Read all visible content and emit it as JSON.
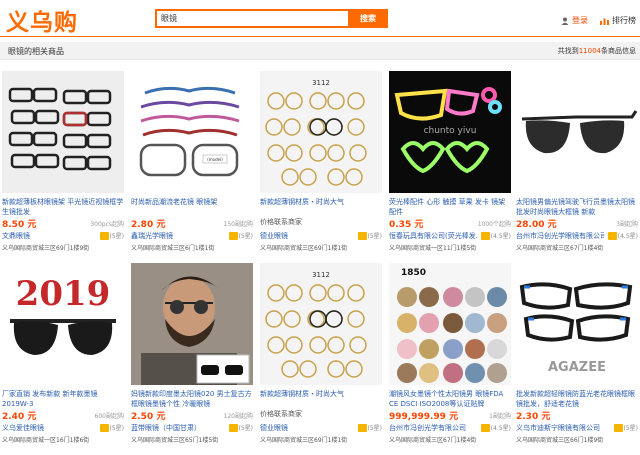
{
  "header": {
    "logo": "义乌购",
    "search_value": "眼镜",
    "search_button": "搜索",
    "login": "登录",
    "ranking": "排行榜"
  },
  "subbar": {
    "title": "眼镜的相关商品",
    "count_prefix": "共找到",
    "count": "11004",
    "count_suffix": "条商品信息"
  },
  "products": [
    {
      "title": "新款超薄板材眼镜架 平光镜近视镜框学生镜批发",
      "price": "8.50 元",
      "sales": "300pcs起购",
      "shop": "文鼎眼镜",
      "rating": "(5星)",
      "addr": "义乌国际商贸城三区69门1楼9街"
    },
    {
      "title": "时尚新品潮流老花镜 眼镜架",
      "price": "2.80 元",
      "sales": "150副起购",
      "shop": "鑫瑞光学眼镜",
      "rating": "(5星)",
      "addr": "义乌国际商贸城三区6门1楼1街"
    },
    {
      "title": "新款超薄钢材质・时尚大气",
      "price": "价格联系商家",
      "sales": "",
      "shop": "德业眼镜",
      "rating": "(5星)",
      "addr": "义乌国际商贸城三区69门1楼1街"
    },
    {
      "title": "荧光棒配件 心形 触摸 草果 发卡 镜架配件",
      "price": "0.35 元",
      "sales": "1000个起购",
      "shop": "恒春玩具有限公司(荧光棒发...",
      "rating": "(4.5星)",
      "addr": "义乌国际商贸城一区11门1楼5街"
    },
    {
      "title": "太阳镜男偏光镜驾驶飞行员墨镜太阳镜批发时尚眼镜大框镜 新款",
      "price": "28.00 元",
      "sales": "3副起购",
      "shop": "台州市冯创光学眼镜有限公司",
      "rating": "(4.5星)",
      "addr": "义乌国际商贸城三区67门1楼4街"
    },
    {
      "title": "厂家直销 发布新款 新年款墨镜 2019W-3",
      "price": "2.40 元",
      "sales": "600副起购",
      "shop": "义乌爱佳眼镜",
      "rating": "(5星)",
      "addr": "义乌国际商贸城一区16门1楼6街"
    },
    {
      "title": "妈镜新款印度墨太阳镜020 男士复古方框眼镜墨镜个性 冷暖眼镜",
      "price": "2.50 元",
      "sales": "120副起购",
      "shop": "蓝带眼镜（中国甘肃）",
      "rating": "(5星)",
      "addr": "义乌国际商贸城三区65门1楼5街"
    },
    {
      "title": "新款超薄钢材质・时尚大气",
      "price": "价格联系商家",
      "sales": "",
      "shop": "德业眼镜",
      "rating": "(5星)",
      "addr": "义乌国际商贸城三区69门1楼1街"
    },
    {
      "title": "潮镜风女墨镜个性太阳镜男 眼镜FDA CE DSCI ISO2008等认证贴牌",
      "price": "999,999.99 元",
      "sales": "1副起购",
      "shop": "台州市冯创光学有限公司",
      "rating": "(4.5星)",
      "addr": "义乌国际商贸城三区67门1楼4街"
    },
    {
      "title": "批发新款超轻眼镜防蓝光老花眼镜框眼镜批发，舒适老花镜",
      "price": "2.30 元",
      "sales": "",
      "shop": "义乌市迪斯宁眼镜有限公司",
      "rating": "(5星)",
      "addr": "义乌国际商贸城三区66门1楼9街"
    }
  ],
  "image_text": {
    "p3": "3112",
    "p4": "chunto yivu",
    "p6": "2019",
    "p9": "1850",
    "p10": "AGAZEE"
  }
}
